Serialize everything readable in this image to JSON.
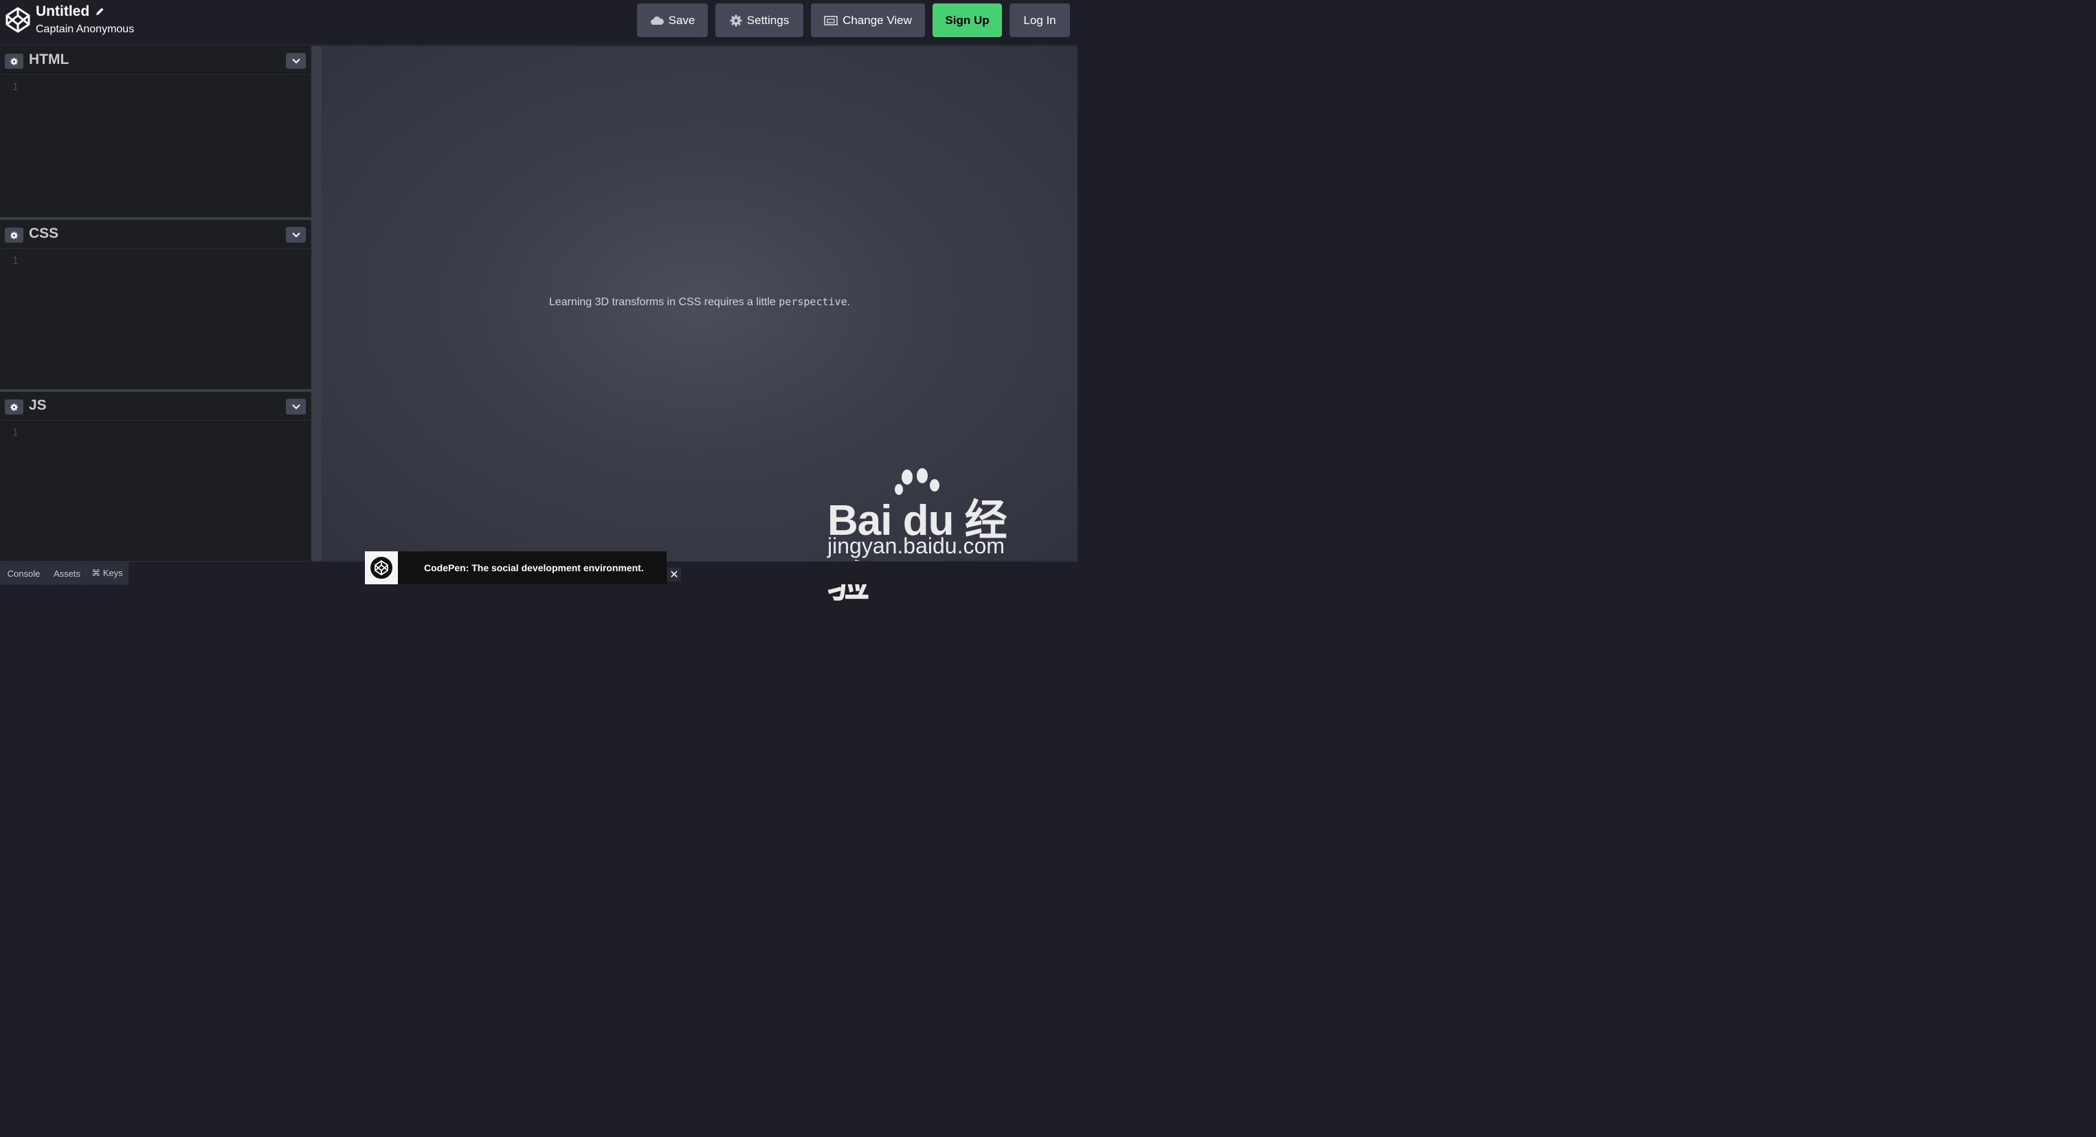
{
  "header": {
    "logo_icon": "codepen-logo-icon",
    "title": "Untitled",
    "author": "Captain Anonymous",
    "edit_icon": "pencil-icon",
    "buttons": {
      "save": "Save",
      "settings": "Settings",
      "change_view": "Change View",
      "sign_up": "Sign Up",
      "log_in": "Log In"
    }
  },
  "editors": [
    {
      "lang": "HTML",
      "line": "1"
    },
    {
      "lang": "CSS",
      "line": "1"
    },
    {
      "lang": "JS",
      "line": "1"
    }
  ],
  "preview": {
    "text_before": "Learning 3D transforms in CSS requires a little ",
    "code": "perspective",
    "text_after": "."
  },
  "footer": {
    "console": "Console",
    "assets": "Assets",
    "keys": "⌘ Keys"
  },
  "toast": {
    "text": "CodePen: The social development environment.",
    "close": "✕"
  },
  "watermark": {
    "brand": "Bai du 经验",
    "url": "jingyan.baidu.com"
  },
  "colors": {
    "signup_green": "#47cf73",
    "button_bg": "#444857",
    "header_bg": "#1e1f26"
  }
}
